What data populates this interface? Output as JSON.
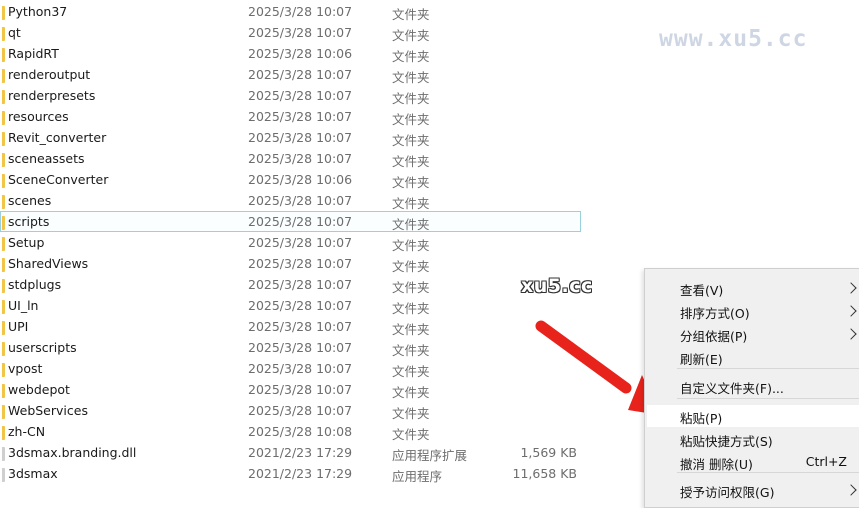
{
  "files": [
    {
      "name": "Python37",
      "date": "2025/3/28 10:07",
      "type": "文件夹",
      "size": ""
    },
    {
      "name": "qt",
      "date": "2025/3/28 10:07",
      "type": "文件夹",
      "size": ""
    },
    {
      "name": "RapidRT",
      "date": "2025/3/28 10:06",
      "type": "文件夹",
      "size": ""
    },
    {
      "name": "renderoutput",
      "date": "2025/3/28 10:07",
      "type": "文件夹",
      "size": ""
    },
    {
      "name": "renderpresets",
      "date": "2025/3/28 10:07",
      "type": "文件夹",
      "size": ""
    },
    {
      "name": "resources",
      "date": "2025/3/28 10:07",
      "type": "文件夹",
      "size": ""
    },
    {
      "name": "Revit_converter",
      "date": "2025/3/28 10:07",
      "type": "文件夹",
      "size": ""
    },
    {
      "name": "sceneassets",
      "date": "2025/3/28 10:07",
      "type": "文件夹",
      "size": ""
    },
    {
      "name": "SceneConverter",
      "date": "2025/3/28 10:06",
      "type": "文件夹",
      "size": ""
    },
    {
      "name": "scenes",
      "date": "2025/3/28 10:07",
      "type": "文件夹",
      "size": ""
    },
    {
      "name": "scripts",
      "date": "2025/3/28 10:07",
      "type": "文件夹",
      "size": ""
    },
    {
      "name": "Setup",
      "date": "2025/3/28 10:07",
      "type": "文件夹",
      "size": ""
    },
    {
      "name": "SharedViews",
      "date": "2025/3/28 10:07",
      "type": "文件夹",
      "size": ""
    },
    {
      "name": "stdplugs",
      "date": "2025/3/28 10:07",
      "type": "文件夹",
      "size": ""
    },
    {
      "name": "UI_ln",
      "date": "2025/3/28 10:07",
      "type": "文件夹",
      "size": ""
    },
    {
      "name": "UPI",
      "date": "2025/3/28 10:07",
      "type": "文件夹",
      "size": ""
    },
    {
      "name": "userscripts",
      "date": "2025/3/28 10:07",
      "type": "文件夹",
      "size": ""
    },
    {
      "name": "vpost",
      "date": "2025/3/28 10:07",
      "type": "文件夹",
      "size": ""
    },
    {
      "name": "webdepot",
      "date": "2025/3/28 10:07",
      "type": "文件夹",
      "size": ""
    },
    {
      "name": "WebServices",
      "date": "2025/3/28 10:07",
      "type": "文件夹",
      "size": ""
    },
    {
      "name": "zh-CN",
      "date": "2025/3/28 10:08",
      "type": "文件夹",
      "size": ""
    },
    {
      "name": "3dsmax.branding.dll",
      "date": "2021/2/23 17:29",
      "type": "应用程序扩展",
      "size": "1,569 KB"
    },
    {
      "name": "3dsmax",
      "date": "2021/2/23 17:29",
      "type": "应用程序",
      "size": "11,658 KB"
    }
  ],
  "selected_file": "scripts",
  "watermarks": {
    "top": "www.xu5.cc",
    "middle": "xu5.cc"
  },
  "context_menu": {
    "items": [
      {
        "label": "查看(V)",
        "shortcut": "",
        "submenu": true,
        "separator_before": false,
        "highlighted": false
      },
      {
        "label": "排序方式(O)",
        "shortcut": "",
        "submenu": true,
        "separator_before": false,
        "highlighted": false
      },
      {
        "label": "分组依据(P)",
        "shortcut": "",
        "submenu": true,
        "separator_before": false,
        "highlighted": false
      },
      {
        "label": "刷新(E)",
        "shortcut": "",
        "submenu": false,
        "separator_before": false,
        "highlighted": false
      },
      {
        "label": "自定义文件夹(F)...",
        "shortcut": "",
        "submenu": false,
        "separator_before": true,
        "highlighted": false
      },
      {
        "label": "粘贴(P)",
        "shortcut": "",
        "submenu": false,
        "separator_before": true,
        "highlighted": true
      },
      {
        "label": "粘贴快捷方式(S)",
        "shortcut": "",
        "submenu": false,
        "separator_before": false,
        "highlighted": false
      },
      {
        "label": "撤消 删除(U)",
        "shortcut": "Ctrl+Z",
        "submenu": false,
        "separator_before": false,
        "highlighted": false
      },
      {
        "label": "授予访问权限(G)",
        "shortcut": "",
        "submenu": true,
        "separator_before": true,
        "highlighted": false
      }
    ]
  },
  "colors": {
    "annotation_arrow": "#e8231c",
    "selection_border": "#99d1dc",
    "folder_icon": "#f0c548"
  }
}
